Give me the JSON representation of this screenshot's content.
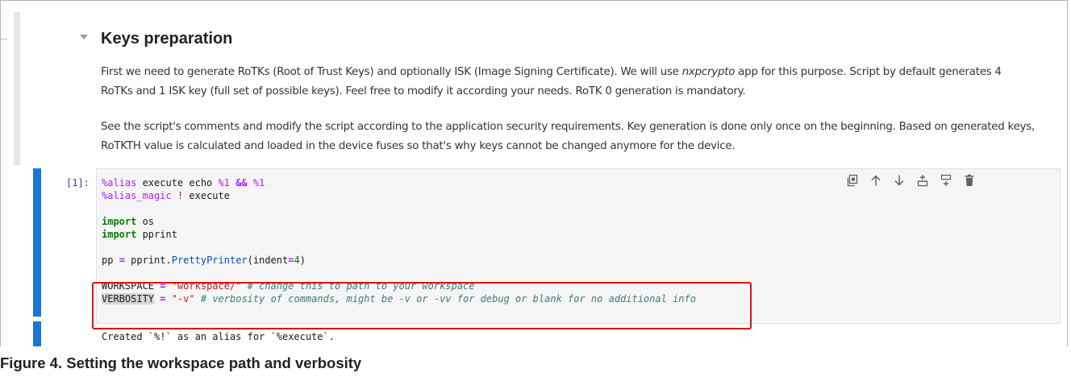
{
  "markdown": {
    "heading": "Keys preparation",
    "paragraph1": {
      "pre": "First we need to generate RoTKs (Root of Trust Keys) and optionally ISK (Image Signing Certificate). We will use ",
      "app": "nxpcrypto",
      "post": " app for this purpose. Script by default generates 4 RoTKs and 1 ISK key (full set of possible keys). Feel free to modify it according your needs. RoTK 0 generation is mandatory."
    },
    "paragraph2": "See the script's comments and modify the script according to the application security requirements. Key generation is done only once on the beginning. Based on generated keys, RoTKTH value is calculated and loaded in the device fuses so that's why keys cannot be changed anymore for the device."
  },
  "cell": {
    "prompt": "[1]:",
    "code": {
      "l1": {
        "a": "%alias",
        "b": " execute echo ",
        "c": "%1",
        "d": " ",
        "e": "&&",
        "f": " ",
        "g": "%1"
      },
      "l2": {
        "a": "%alias_magic",
        "b": " ",
        "c": "!",
        "d": " execute"
      },
      "l4": {
        "a": "import",
        "b": " os"
      },
      "l5": {
        "a": "import",
        "b": " pprint"
      },
      "l7": {
        "a": "pp ",
        "b": "=",
        "c": " pprint.",
        "d": "PrettyPrinter",
        "e": "(indent",
        "f": "=",
        "g": "4",
        "h": ")"
      },
      "l9": {
        "a": "WORKSPACE ",
        "b": "=",
        "c": " ",
        "d": "\"workspace/\"",
        "e": " ",
        "f": "# change this to path to your workspace"
      },
      "l10": {
        "a": "VERBOSITY",
        "b": " ",
        "c": "=",
        "d": " ",
        "e": "\"-v\"",
        "f": " ",
        "g": "# verbosity of commands, might be -v or -vv for debug or blank for no additional info"
      }
    },
    "output": "Created `%!` as an alias for `%execute`.",
    "toolbar": [
      "duplicate-icon",
      "move-up-icon",
      "move-down-icon",
      "insert-above-icon",
      "insert-below-icon",
      "delete-icon"
    ]
  },
  "caption": "Figure 4.  Setting the workspace path and verbosity",
  "colors": {
    "accent": "#1976d2",
    "highlight_box": "#e01010"
  }
}
